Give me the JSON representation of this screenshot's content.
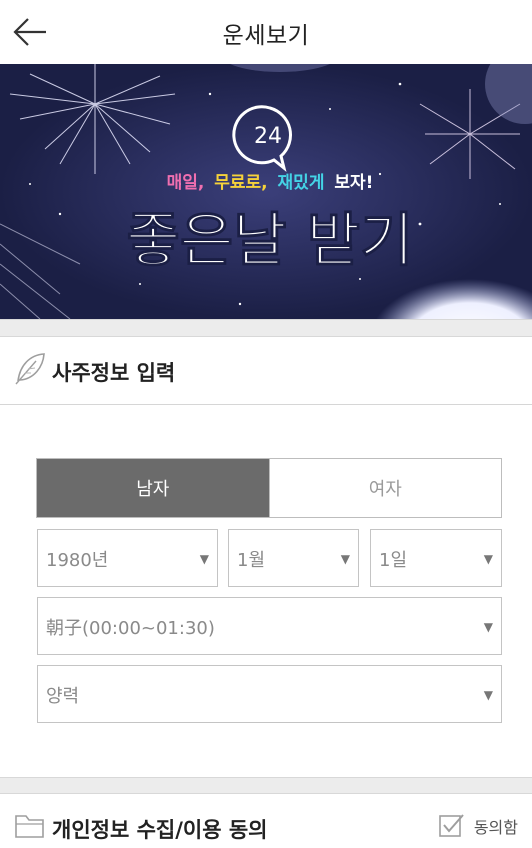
{
  "header": {
    "title": "운세보기",
    "back_icon": "arrow-left-icon"
  },
  "banner": {
    "badge": "24",
    "tagline_part1": "매일,",
    "tagline_part2": "무료로,",
    "tagline_part3": "재밌게",
    "tagline_part4": "보자!",
    "headline": "좋은날 받기",
    "colors": {
      "bg": "#1b1f45",
      "pink": "#f06fb0",
      "yellow": "#f5d23a",
      "cyan": "#44d3e6"
    }
  },
  "saju": {
    "section_title": "사주정보 입력",
    "icon": "leaf-icon",
    "gender": {
      "male": "남자",
      "female": "여자",
      "selected": "male"
    },
    "year": "1980년",
    "month": "1월",
    "day": "1일",
    "time": "朝子(00:00~01:30)",
    "calendar": "양력"
  },
  "privacy": {
    "section_title": "개인정보 수집/이용 동의",
    "icon": "folder-icon",
    "agree_label": "동의함",
    "agree_icon": "checkbox-check-icon"
  }
}
